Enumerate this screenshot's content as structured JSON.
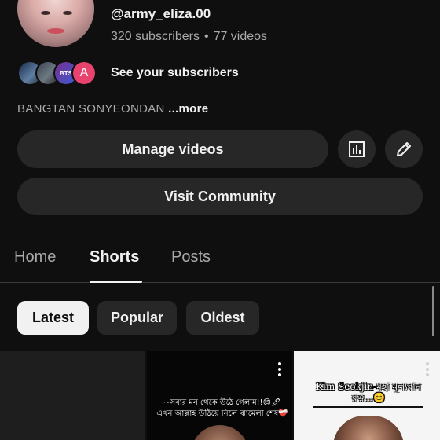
{
  "channel": {
    "handle": "@army_eliza.00",
    "subscribers": "320 subscribers",
    "separator": "•",
    "videos": "77 videos",
    "see_subscribers": "See your subscribers",
    "description": "BANGTAN SONYEONDAN",
    "more_label": "...more",
    "subscriber_avatars": [
      {
        "icon": "avatar-photo"
      },
      {
        "icon": "avatar-photo"
      },
      {
        "icon": "avatar-bts-logo",
        "text": "BTS"
      },
      {
        "icon": "avatar-letter",
        "text": "A"
      }
    ]
  },
  "actions": {
    "manage_videos": "Manage videos",
    "analytics_icon": "bar-chart-icon",
    "edit_icon": "pencil-icon",
    "visit_community": "Visit Community"
  },
  "tabs": [
    {
      "label": "Home",
      "active": false
    },
    {
      "label": "Shorts",
      "active": true
    },
    {
      "label": "Posts",
      "active": false
    }
  ],
  "filters": [
    {
      "label": "Latest",
      "active": true
    },
    {
      "label": "Popular",
      "active": false
    },
    {
      "label": "Oldest",
      "active": false
    }
  ],
  "shorts": [
    {
      "caption": ""
    },
    {
      "caption_line1": "~সবার মন থেকে উঠে গেলাম!!😊🖋",
      "caption_line2": "এখন আল্লাহ উঠিয়ে নিলে ঝামেলা শেষ❤️‍🩹"
    },
    {
      "title": "Kim Seokjin-মহা মূল্যবান রত্ন...😊"
    }
  ],
  "colors": {
    "background": "#0f0f0f",
    "pill": "#272727",
    "text_primary": "#f1f1f1",
    "text_secondary": "#aaaaaa",
    "accent_avatar": "#e8436f"
  }
}
